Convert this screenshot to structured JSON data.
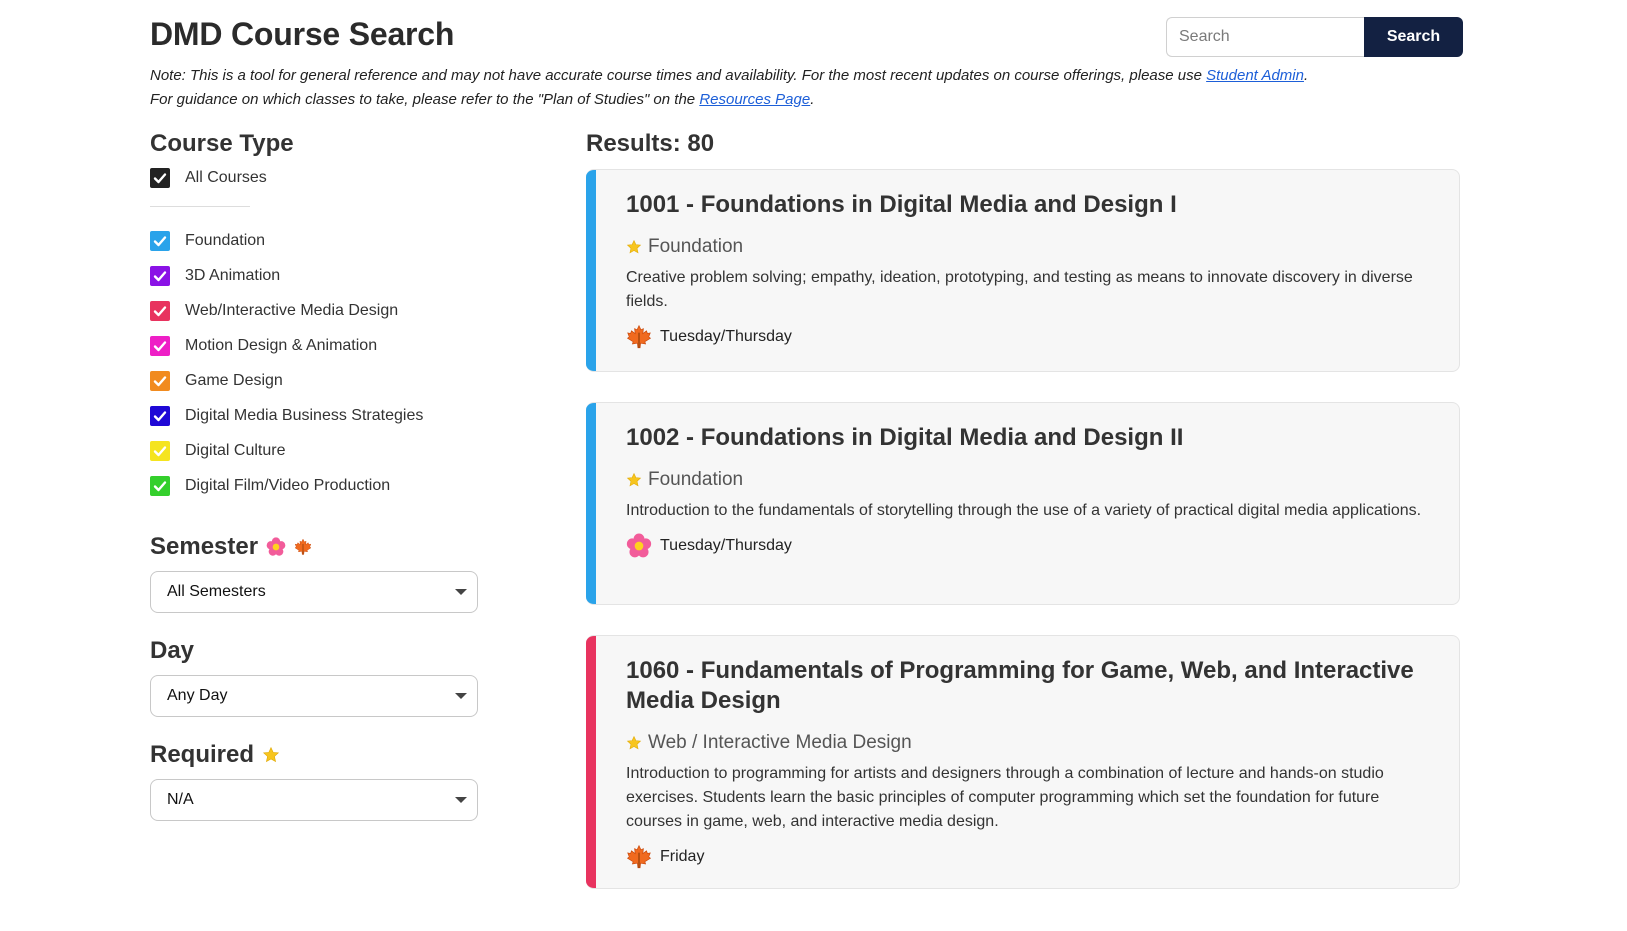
{
  "header": {
    "title": "DMD Course Search",
    "search_placeholder": "Search",
    "search_button": "Search"
  },
  "note": {
    "line1_text": "Note: This is a tool for general reference and may not have accurate course times and availability. For the most recent updates on course offerings, please use ",
    "line1_link": "Student Admin",
    "line1_end": ".",
    "line2_text": "For guidance on which classes to take, please refer to the \"Plan of Studies\" on the ",
    "line2_link": "Resources Page",
    "line2_end": "."
  },
  "sidebar": {
    "course_type_title": "Course Type",
    "all_courses": {
      "label": "All Courses",
      "color": "#222222",
      "checked": true
    },
    "types": [
      {
        "label": "Foundation",
        "color": "#2aa3ea",
        "checked": true
      },
      {
        "label": "3D Animation",
        "color": "#8a12e6",
        "checked": true
      },
      {
        "label": "Web/Interactive Media Design",
        "color": "#e8335f",
        "checked": true
      },
      {
        "label": "Motion Design & Animation",
        "color": "#ee1fc6",
        "checked": true
      },
      {
        "label": "Game Design",
        "color": "#f18b1f",
        "checked": true
      },
      {
        "label": "Digital Media Business Strategies",
        "color": "#1f08d6",
        "checked": true
      },
      {
        "label": "Digital Culture",
        "color": "#f5e41f",
        "checked": true
      },
      {
        "label": "Digital Film/Video Production",
        "color": "#34cf2c",
        "checked": true
      }
    ],
    "semester_title": "Semester",
    "semester_icons": [
      "flower-icon",
      "maple-leaf-icon"
    ],
    "semester_value": "All Semesters",
    "day_title": "Day",
    "day_value": "Any Day",
    "required_title": "Required",
    "required_icon": "star-icon",
    "required_value": "N/A"
  },
  "results": {
    "label": "Results: 80",
    "courses": [
      {
        "title": "1001 - Foundations in Digital Media and Design I",
        "type": "Foundation",
        "accent": "#2aa3ea",
        "description": "Creative problem solving; empathy, ideation, prototyping, and testing as means to innovate discovery in diverse fields.",
        "semester_icon": "maple-leaf-icon",
        "days": "Tuesday/Thursday"
      },
      {
        "title": "1002 - Foundations in Digital Media and Design II",
        "type": "Foundation",
        "accent": "#2aa3ea",
        "description": "Introduction to the fundamentals of storytelling through the use of a variety of practical digital media applications.",
        "semester_icon": "flower-icon",
        "days": "Tuesday/Thursday"
      },
      {
        "title": "1060 - Fundamentals of Programming for Game, Web, and Interactive Media Design",
        "type": "Web / Interactive Media Design",
        "accent": "#e8335f",
        "description": "Introduction to programming for artists and designers through a combination of lecture and hands-on studio exercises. Students learn the basic principles of computer programming which set the foundation for future courses in game, web, and interactive media design.",
        "semester_icon": "maple-leaf-icon",
        "days": "Friday"
      }
    ]
  }
}
